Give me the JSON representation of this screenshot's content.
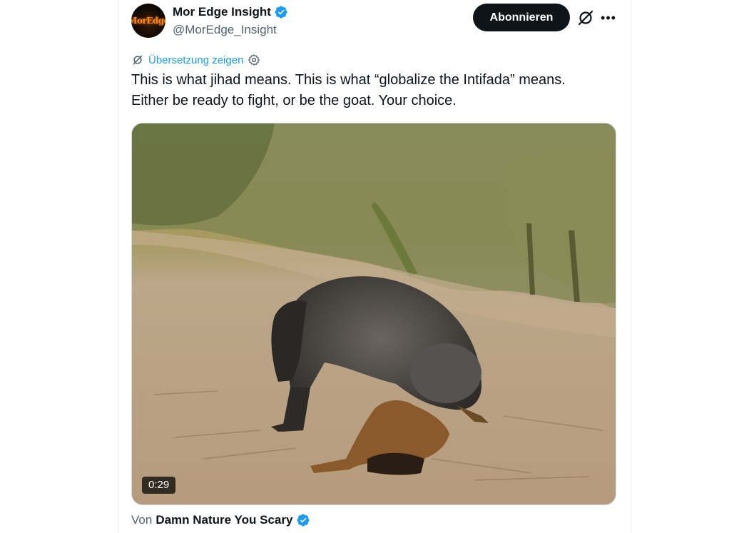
{
  "author": {
    "avatar_text": "MorEdge",
    "name": "Mor Edge Insight",
    "handle": "@MorEdge_Insight"
  },
  "actions": {
    "follow_label": "Abonnieren",
    "grok_icon": "grok-icon",
    "more_icon": "more-icon"
  },
  "translate": {
    "label": "Übersetzung zeigen"
  },
  "tweet": {
    "line1": "This is what jihad means. This is what “globalize the Intifada” means.",
    "line2": "Either be ready to fight, or be the goat. Your choice."
  },
  "media": {
    "duration": "0:29"
  },
  "source": {
    "prefix": "Von",
    "name": "Damn Nature You Scary"
  },
  "colors": {
    "accent": "#1d9bf0",
    "verified": "#1d9bf0",
    "text": "#0f1419",
    "muted": "#536471"
  }
}
